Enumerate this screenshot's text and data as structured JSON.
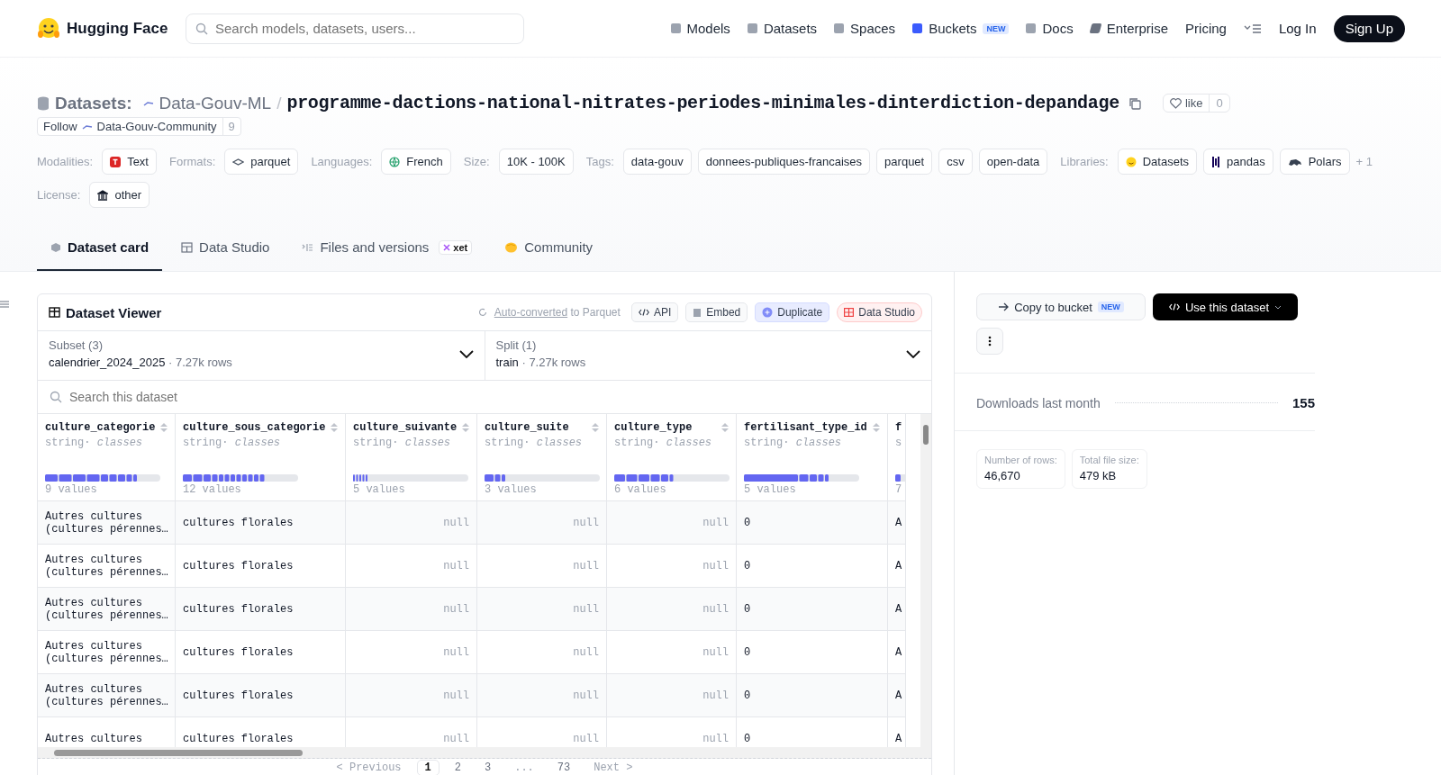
{
  "nav": {
    "brand": "Hugging Face",
    "search": {
      "placeholder": "Search models, datasets, users..."
    },
    "links": [
      {
        "label": "Models"
      },
      {
        "label": "Datasets"
      },
      {
        "label": "Spaces"
      },
      {
        "label": "Buckets",
        "badge": "NEW"
      },
      {
        "label": "Docs"
      },
      {
        "label": "Enterprise"
      },
      {
        "label": "Pricing"
      }
    ],
    "login": "Log In",
    "signup": "Sign Up"
  },
  "repo": {
    "prefix": "Datasets:",
    "owner": "Data-Gouv-ML",
    "separator": "/",
    "name": "programme-dactions-national-nitrates-periodes-minimales-dinterdiction-depandage",
    "like": "like",
    "likes": "0",
    "follow": "Follow",
    "org": "Data-Gouv-Community",
    "followers": "9"
  },
  "tag_groups": [
    {
      "label": "Modalities:",
      "chips": [
        "Text"
      ]
    },
    {
      "label": "Formats:",
      "chips": [
        "parquet"
      ]
    },
    {
      "label": "Languages:",
      "chips": [
        "French"
      ]
    },
    {
      "label": "Size:",
      "chips": [
        "10K - 100K"
      ]
    },
    {
      "label": "Tags:",
      "chips": [
        "data-gouv",
        "donnees-publiques-francaises",
        "parquet",
        "csv",
        "open-data"
      ]
    },
    {
      "label": "Libraries:",
      "chips": [
        "Datasets",
        "pandas",
        "Polars"
      ],
      "more": "+ 1"
    },
    {
      "label": "License:",
      "chips": [
        "other"
      ]
    }
  ],
  "tabs": [
    {
      "label": "Dataset card",
      "selected": true
    },
    {
      "label": "Data Studio",
      "selected": false
    },
    {
      "label": "Files and versions",
      "badge": "xet",
      "selected": false
    },
    {
      "label": "Community",
      "selected": false
    }
  ],
  "viewer": {
    "title": "Dataset Viewer",
    "converted_link": "Auto-converted",
    "converted_rest": "to Parquet",
    "buttons": [
      "API",
      "Embed",
      "Duplicate",
      "Data Studio"
    ],
    "subset": {
      "label": "Subset (3)",
      "value": "calendrier_2024_2025",
      "separator": "·",
      "rows": "7.27k rows"
    },
    "split": {
      "label": "Split (1)",
      "value": "train",
      "separator": "·",
      "rows": "7.27k rows"
    },
    "search": {
      "placeholder": "Search this dataset"
    },
    "columns": [
      {
        "name": "culture_categorie",
        "type": "string",
        "separator": "·",
        "hint": "classes",
        "values": "9 values"
      },
      {
        "name": "culture_sous_categorie",
        "type": "string",
        "separator": "·",
        "hint": "classes",
        "values": "12 values"
      },
      {
        "name": "culture_suivante",
        "type": "string",
        "separator": "·",
        "hint": "classes",
        "values": "5 values"
      },
      {
        "name": "culture_suite",
        "type": "string",
        "separator": "·",
        "hint": "classes",
        "values": "3 values"
      },
      {
        "name": "culture_type",
        "type": "string",
        "separator": "·",
        "hint": "classes",
        "values": "6 values"
      },
      {
        "name": "fertilisant_type_id",
        "type": "string",
        "separator": "·",
        "hint": "classes",
        "values": "5 values"
      },
      {
        "name": "f",
        "type": "s",
        "values": "7"
      }
    ],
    "rows": [
      {
        "cells": [
          {
            "kind": "value",
            "text": "Autres cultures\n(cultures pérennes…"
          },
          {
            "kind": "value",
            "text": "cultures florales"
          },
          {
            "kind": "null",
            "text": "null"
          },
          {
            "kind": "null",
            "text": "null"
          },
          {
            "kind": "null",
            "text": "null"
          },
          {
            "kind": "value",
            "text": "0"
          },
          {
            "kind": "value",
            "text": "A"
          }
        ]
      },
      {
        "cells": [
          {
            "kind": "value",
            "text": "Autres cultures\n(cultures pérennes…"
          },
          {
            "kind": "value",
            "text": "cultures florales"
          },
          {
            "kind": "null",
            "text": "null"
          },
          {
            "kind": "null",
            "text": "null"
          },
          {
            "kind": "null",
            "text": "null"
          },
          {
            "kind": "value",
            "text": "0"
          },
          {
            "kind": "value",
            "text": "A"
          }
        ]
      },
      {
        "cells": [
          {
            "kind": "value",
            "text": "Autres cultures\n(cultures pérennes…"
          },
          {
            "kind": "value",
            "text": "cultures florales"
          },
          {
            "kind": "null",
            "text": "null"
          },
          {
            "kind": "null",
            "text": "null"
          },
          {
            "kind": "null",
            "text": "null"
          },
          {
            "kind": "value",
            "text": "0"
          },
          {
            "kind": "value",
            "text": "A"
          }
        ]
      },
      {
        "cells": [
          {
            "kind": "value",
            "text": "Autres cultures\n(cultures pérennes…"
          },
          {
            "kind": "value",
            "text": "cultures florales"
          },
          {
            "kind": "null",
            "text": "null"
          },
          {
            "kind": "null",
            "text": "null"
          },
          {
            "kind": "null",
            "text": "null"
          },
          {
            "kind": "value",
            "text": "0"
          },
          {
            "kind": "value",
            "text": "A"
          }
        ]
      },
      {
        "cells": [
          {
            "kind": "value",
            "text": "Autres cultures\n(cultures pérennes…"
          },
          {
            "kind": "value",
            "text": "cultures florales"
          },
          {
            "kind": "null",
            "text": "null"
          },
          {
            "kind": "null",
            "text": "null"
          },
          {
            "kind": "null",
            "text": "null"
          },
          {
            "kind": "value",
            "text": "0"
          },
          {
            "kind": "value",
            "text": "A"
          }
        ]
      },
      {
        "cells": [
          {
            "kind": "value",
            "text": "Autres cultures"
          },
          {
            "kind": "value",
            "text": "cultures florales"
          },
          {
            "kind": "null",
            "text": "null"
          },
          {
            "kind": "null",
            "text": "null"
          },
          {
            "kind": "null",
            "text": "null"
          },
          {
            "kind": "value",
            "text": "0"
          },
          {
            "kind": "value",
            "text": "A"
          }
        ]
      }
    ],
    "pagination": [
      {
        "label": "< Previous",
        "kind": "nav",
        "selected": false
      },
      {
        "label": "1",
        "kind": "page",
        "selected": true
      },
      {
        "label": "2",
        "kind": "page",
        "selected": false
      },
      {
        "label": "3",
        "kind": "page",
        "selected": false
      },
      {
        "label": "...",
        "kind": "gap",
        "selected": false
      },
      {
        "label": "73",
        "kind": "page",
        "selected": false
      },
      {
        "label": "Next >",
        "kind": "nav",
        "selected": false
      }
    ]
  },
  "sidebar": {
    "copy": "Copy to bucket",
    "copy_badge": "NEW",
    "use": "Use this dataset",
    "downloads_label": "Downloads last month",
    "downloads": "155",
    "stats": [
      {
        "label": "Number of rows:",
        "value": "46,670"
      },
      {
        "label": "Total file size:",
        "value": "479 kB"
      }
    ]
  }
}
